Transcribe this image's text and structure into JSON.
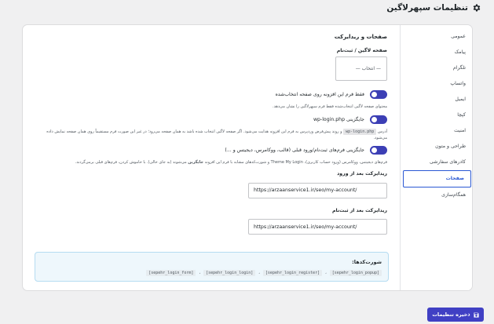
{
  "page": {
    "title": "تنظیمات سپهرلاگین"
  },
  "sidebar": {
    "items": [
      {
        "label": "عمومی"
      },
      {
        "label": "پیامک"
      },
      {
        "label": "تلگرام"
      },
      {
        "label": "واتساپ"
      },
      {
        "label": "ایمیل"
      },
      {
        "label": "کپچا"
      },
      {
        "label": "امنیت"
      },
      {
        "label": "طراحی و متون"
      },
      {
        "label": "کادرهای سفارشی"
      },
      {
        "label": "صفحات"
      },
      {
        "label": "همگام‌سازی"
      }
    ],
    "active_index": 9
  },
  "section": {
    "title": "صفحات و ریدایرکت",
    "login_page": {
      "label": "صفحه لاگین / ثبت‌نام",
      "select_value": "— انتخاب —"
    },
    "only_form_toggle": {
      "label": "فقط فرم این افزونه روی صفحه انتخاب‌شده",
      "desc": "محتوای صفحه لاگین انتخاب‌شده فقط فرم سپهرلاگین را نشان می‌دهد."
    },
    "wp_login_toggle": {
      "label": "جایگزینی wp-login.php",
      "desc_part1": "آدرس",
      "desc_code": "wp-login.php",
      "desc_part2": "و روند پیش‌فرض وردپرس به فرم این افزونه هدایت می‌شود. اگر صفحه لاگین انتخاب شده باشد به همان صفحه می‌رود؛ در غیر این صورت فرم مستقیماً روی همان صفحه نمایش داده می‌شود."
    },
    "replace_forms_toggle": {
      "label": "جایگزینی فرم‌های ثبت‌نام/ورود قبلی (قالب، ووکامرس، دیجیتس و ...)",
      "desc_part1": "فرم‌های دیجیتس، ووکامرس (ورود حساب کاربری)، Theme My Login و شورت‌کدهای مشابه با فرم این افزونه",
      "desc_bold": "جایگزین",
      "desc_part2": "می‌شوند (به جای خالی). با خاموش کردن، فرم‌های قبلی برمی‌گردند."
    },
    "redirect_after_login": {
      "label": "ریدایرکت بعد از ورود",
      "value": "https://arzaanservice1.ir/seo/my-account/"
    },
    "redirect_after_register": {
      "label": "ریدایرکت بعد از ثبت‌نام",
      "value": "https://arzaanservice1.ir/seo/my-account/"
    }
  },
  "shortcodes": {
    "title": "شورت‌کدها:",
    "codes": [
      "[sepehr_login_popup]",
      "[sepehr_login_register]",
      "[sepehr_login_login]",
      "[sepehr_login_form]"
    ],
    "separator": "،"
  },
  "footer": {
    "save_label": "ذخیره تنظیمات"
  },
  "colors": {
    "accent": "#3c3fb5",
    "active_tab": "#2a58d3",
    "notice_bg": "#eef7fc"
  }
}
